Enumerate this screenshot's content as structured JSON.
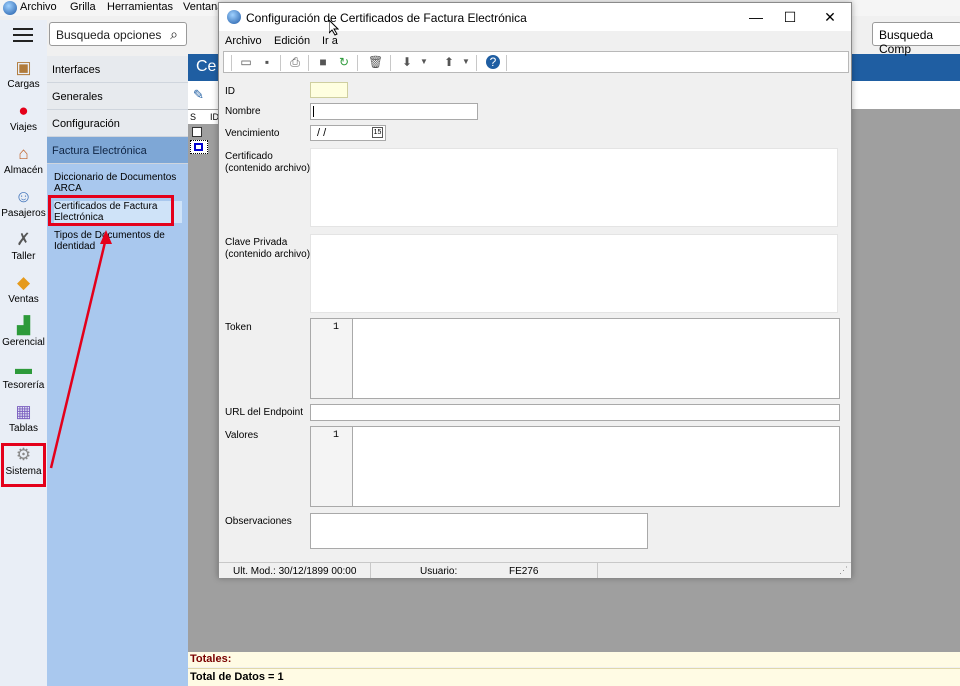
{
  "app_menu": {
    "items": [
      "Archivo",
      "Grilla",
      "Herramientas",
      "Ventana"
    ]
  },
  "left_search": {
    "placeholder": "Busqueda opciones"
  },
  "right_search": {
    "placeholder": "Busqueda Comp"
  },
  "sidebar": {
    "items": [
      {
        "label": "Cargas",
        "icon": "box-icon"
      },
      {
        "label": "Viajes",
        "icon": "map-pin-icon"
      },
      {
        "label": "Almacén",
        "icon": "warehouse-icon"
      },
      {
        "label": "Pasajeros",
        "icon": "passenger-icon"
      },
      {
        "label": "Taller",
        "icon": "wrench-icon"
      },
      {
        "label": "Ventas",
        "icon": "sales-icon"
      },
      {
        "label": "Gerencial",
        "icon": "chart-icon"
      },
      {
        "label": "Tesorería",
        "icon": "cash-icon"
      },
      {
        "label": "Tablas",
        "icon": "table-icon"
      },
      {
        "label": "Sistema",
        "icon": "gear-icon"
      }
    ]
  },
  "nav": {
    "headers": [
      "Interfaces",
      "Generales",
      "Configuración",
      "Factura Electrónica"
    ],
    "subitems": [
      "Diccionario de Documentos ARCA",
      "Certificados de Factura Electrónica",
      "Tipos de Documentos de Identidad"
    ]
  },
  "grid": {
    "title": "Ce",
    "col_s": "S",
    "col_id": "ID"
  },
  "footer": {
    "totals": "Totales:",
    "total_count": "Total de Datos = 1"
  },
  "dialog": {
    "title": "Configuración de Certificados de Factura Electrónica",
    "menu": [
      "Archivo",
      "Edición",
      "Ir a"
    ],
    "fields": {
      "id": "ID",
      "nombre": "Nombre",
      "vencimiento": "Vencimiento",
      "vencimiento_value": "/ /",
      "certificado": "Certificado",
      "certificado_sub": "(contenido archivo)",
      "clave": "Clave Privada",
      "clave_sub": "(contenido archivo)",
      "token": "Token",
      "token_line": "1",
      "url": "URL del Endpoint",
      "valores": "Valores",
      "valores_line": "1",
      "observaciones": "Observaciones"
    },
    "status": {
      "ult_mod": "Ult. Mod.: 30/12/1899 00:00",
      "usuario": "Usuario:",
      "usuario_value": "FE276"
    }
  },
  "colors": {
    "accent": "#1f5ea2",
    "nav": "#a9c8ee",
    "highlight": "#e4001a",
    "footer_bg": "#fffbe4"
  }
}
